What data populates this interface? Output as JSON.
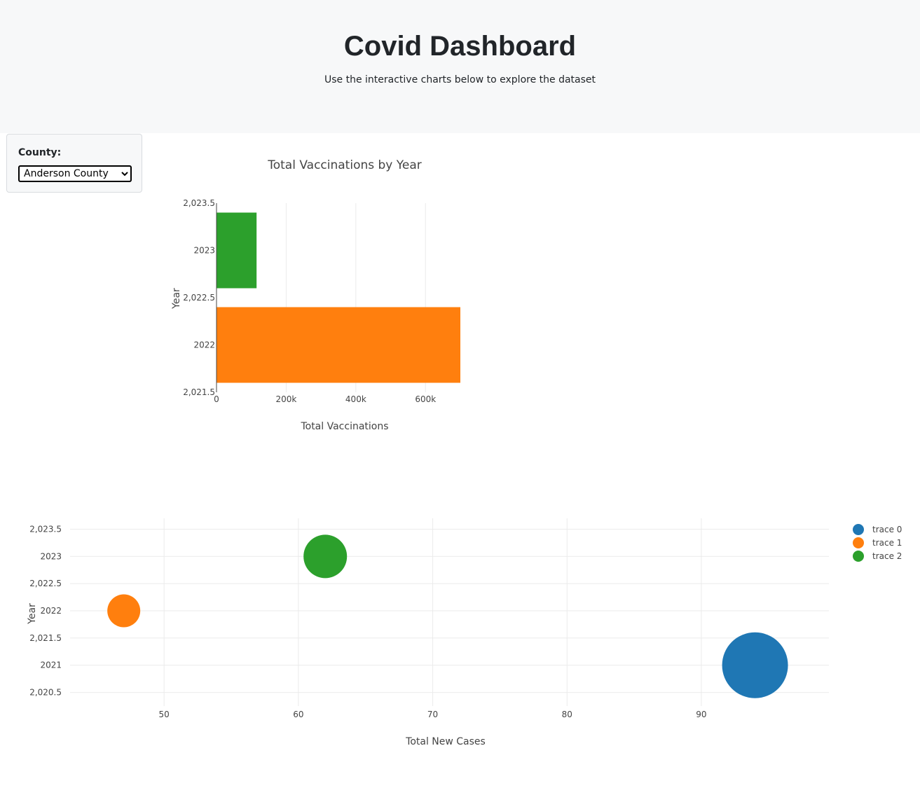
{
  "header": {
    "title": "Covid Dashboard",
    "subtitle": "Use the interactive charts below to explore the dataset"
  },
  "filter": {
    "label": "County:",
    "selected": "Anderson County"
  },
  "chart_data": [
    {
      "type": "bar",
      "orientation": "horizontal",
      "title": "Total Vaccinations by Year",
      "xlabel": "Total Vaccinations",
      "ylabel": "Year",
      "categories": [
        2022,
        2023
      ],
      "values": [
        700000,
        115000
      ],
      "colors": [
        "#ff7f0e",
        "#2ca02c"
      ],
      "xlim": [
        0,
        700000
      ],
      "ylim": [
        2021.5,
        2023.5
      ],
      "xticks": [
        {
          "value": 0,
          "label": "0"
        },
        {
          "value": 200000,
          "label": "200k"
        },
        {
          "value": 400000,
          "label": "400k"
        },
        {
          "value": 600000,
          "label": "600k"
        }
      ],
      "yticks": [
        {
          "value": 2021.5,
          "label": "2,021.5"
        },
        {
          "value": 2022,
          "label": "2022"
        },
        {
          "value": 2022.5,
          "label": "2,022.5"
        },
        {
          "value": 2023,
          "label": "2023"
        },
        {
          "value": 2023.5,
          "label": "2,023.5"
        }
      ],
      "grid": true
    },
    {
      "type": "scatter",
      "title": "",
      "xlabel": "Total New Cases",
      "ylabel": "Year",
      "xlim": [
        43,
        99.5
      ],
      "ylim": [
        2020.25,
        2023.7
      ],
      "series": [
        {
          "name": "trace 0",
          "x": [
            94
          ],
          "y": [
            2021
          ],
          "color": "#1f77b4"
        },
        {
          "name": "trace 1",
          "x": [
            47
          ],
          "y": [
            2022
          ],
          "color": "#ff7f0e"
        },
        {
          "name": "trace 2",
          "x": [
            62
          ],
          "y": [
            2023
          ],
          "color": "#2ca02c"
        }
      ],
      "xticks": [
        {
          "value": 50,
          "label": "50"
        },
        {
          "value": 60,
          "label": "60"
        },
        {
          "value": 70,
          "label": "70"
        },
        {
          "value": 80,
          "label": "80"
        },
        {
          "value": 90,
          "label": "90"
        }
      ],
      "yticks": [
        {
          "value": 2020.5,
          "label": "2,020.5"
        },
        {
          "value": 2021,
          "label": "2021"
        },
        {
          "value": 2021.5,
          "label": "2,021.5"
        },
        {
          "value": 2022,
          "label": "2022"
        },
        {
          "value": 2022.5,
          "label": "2,022.5"
        },
        {
          "value": 2023,
          "label": "2023"
        },
        {
          "value": 2023.5,
          "label": "2,023.5"
        }
      ],
      "grid": true,
      "legend_position": "top-right"
    }
  ]
}
